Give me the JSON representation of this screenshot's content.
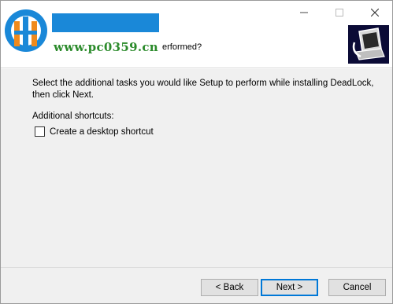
{
  "window": {
    "controls": {
      "minimize_icon": "minimize-icon",
      "maximize_icon": "maximize-icon",
      "close_icon": "close-icon"
    }
  },
  "header": {
    "watermark_url": "www.pc0359.cn",
    "subtitle_fragment": "erformed?",
    "wizard_image_icon": "computer-icon"
  },
  "content": {
    "description": "Select the additional tasks you would like Setup to perform while installing DeadLock, then click Next.",
    "section_label": "Additional shortcuts:",
    "tasks": [
      {
        "label": "Create a desktop shortcut",
        "checked": false
      }
    ]
  },
  "footer": {
    "back_label": "< Back",
    "next_label": "Next >",
    "cancel_label": "Cancel"
  },
  "colors": {
    "content_bg": "#f0f0f0",
    "default_button_border": "#0078d7",
    "watermark_blue": "#1a88d8",
    "watermark_green": "#2a8a2a",
    "wizard_image_bg": "#0b0b36"
  }
}
